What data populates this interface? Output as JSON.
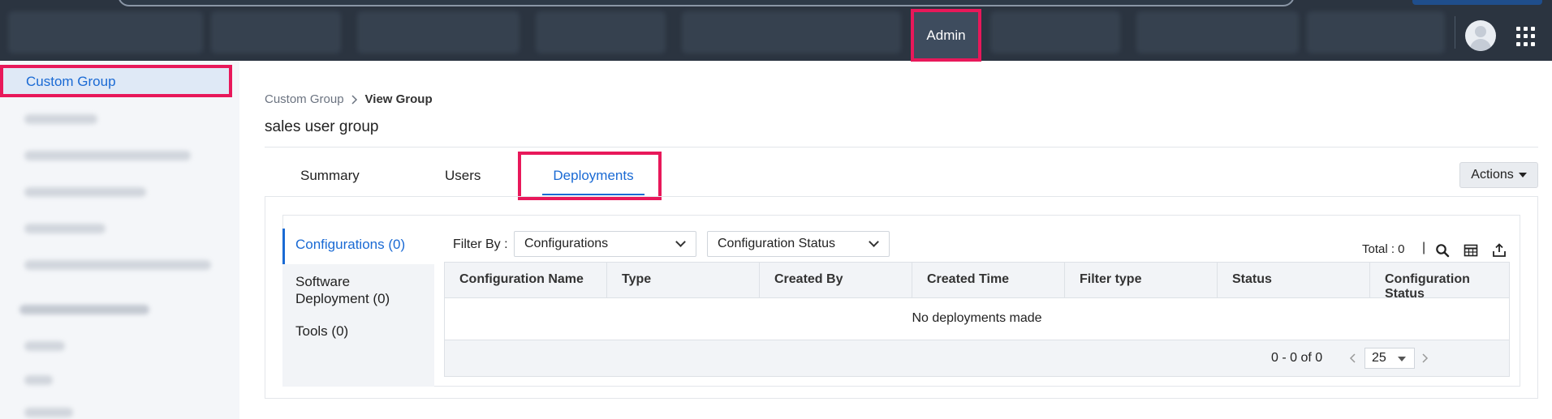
{
  "topbar": {
    "admin_label": "Admin",
    "accent_color": "#e8185a"
  },
  "sidebar": {
    "active_item": "Custom Group"
  },
  "breadcrumb": {
    "parent": "Custom Group",
    "current": "View Group"
  },
  "page": {
    "title": "sales user group"
  },
  "tabs": {
    "summary": "Summary",
    "users": "Users",
    "deployments": "Deployments"
  },
  "actions": {
    "label": "Actions"
  },
  "left_nav": {
    "configurations": "Configurations (0)",
    "software_deployment": "Software Deployment (0)",
    "tools": "Tools (0)"
  },
  "filter": {
    "label": "Filter By :",
    "primary_value": "Configurations",
    "secondary_value": "Configuration Status"
  },
  "toolbar": {
    "total": "Total : 0",
    "separator": "|",
    "icons": [
      "search-icon",
      "columns-icon",
      "export-icon"
    ]
  },
  "table": {
    "columns": [
      "Configuration Name",
      "Type",
      "Created By",
      "Created Time",
      "Filter type",
      "Status",
      "Configuration Status"
    ],
    "empty_message": "No deployments made"
  },
  "pagination": {
    "range": "0 - 0 of 0",
    "page_size": "25"
  }
}
